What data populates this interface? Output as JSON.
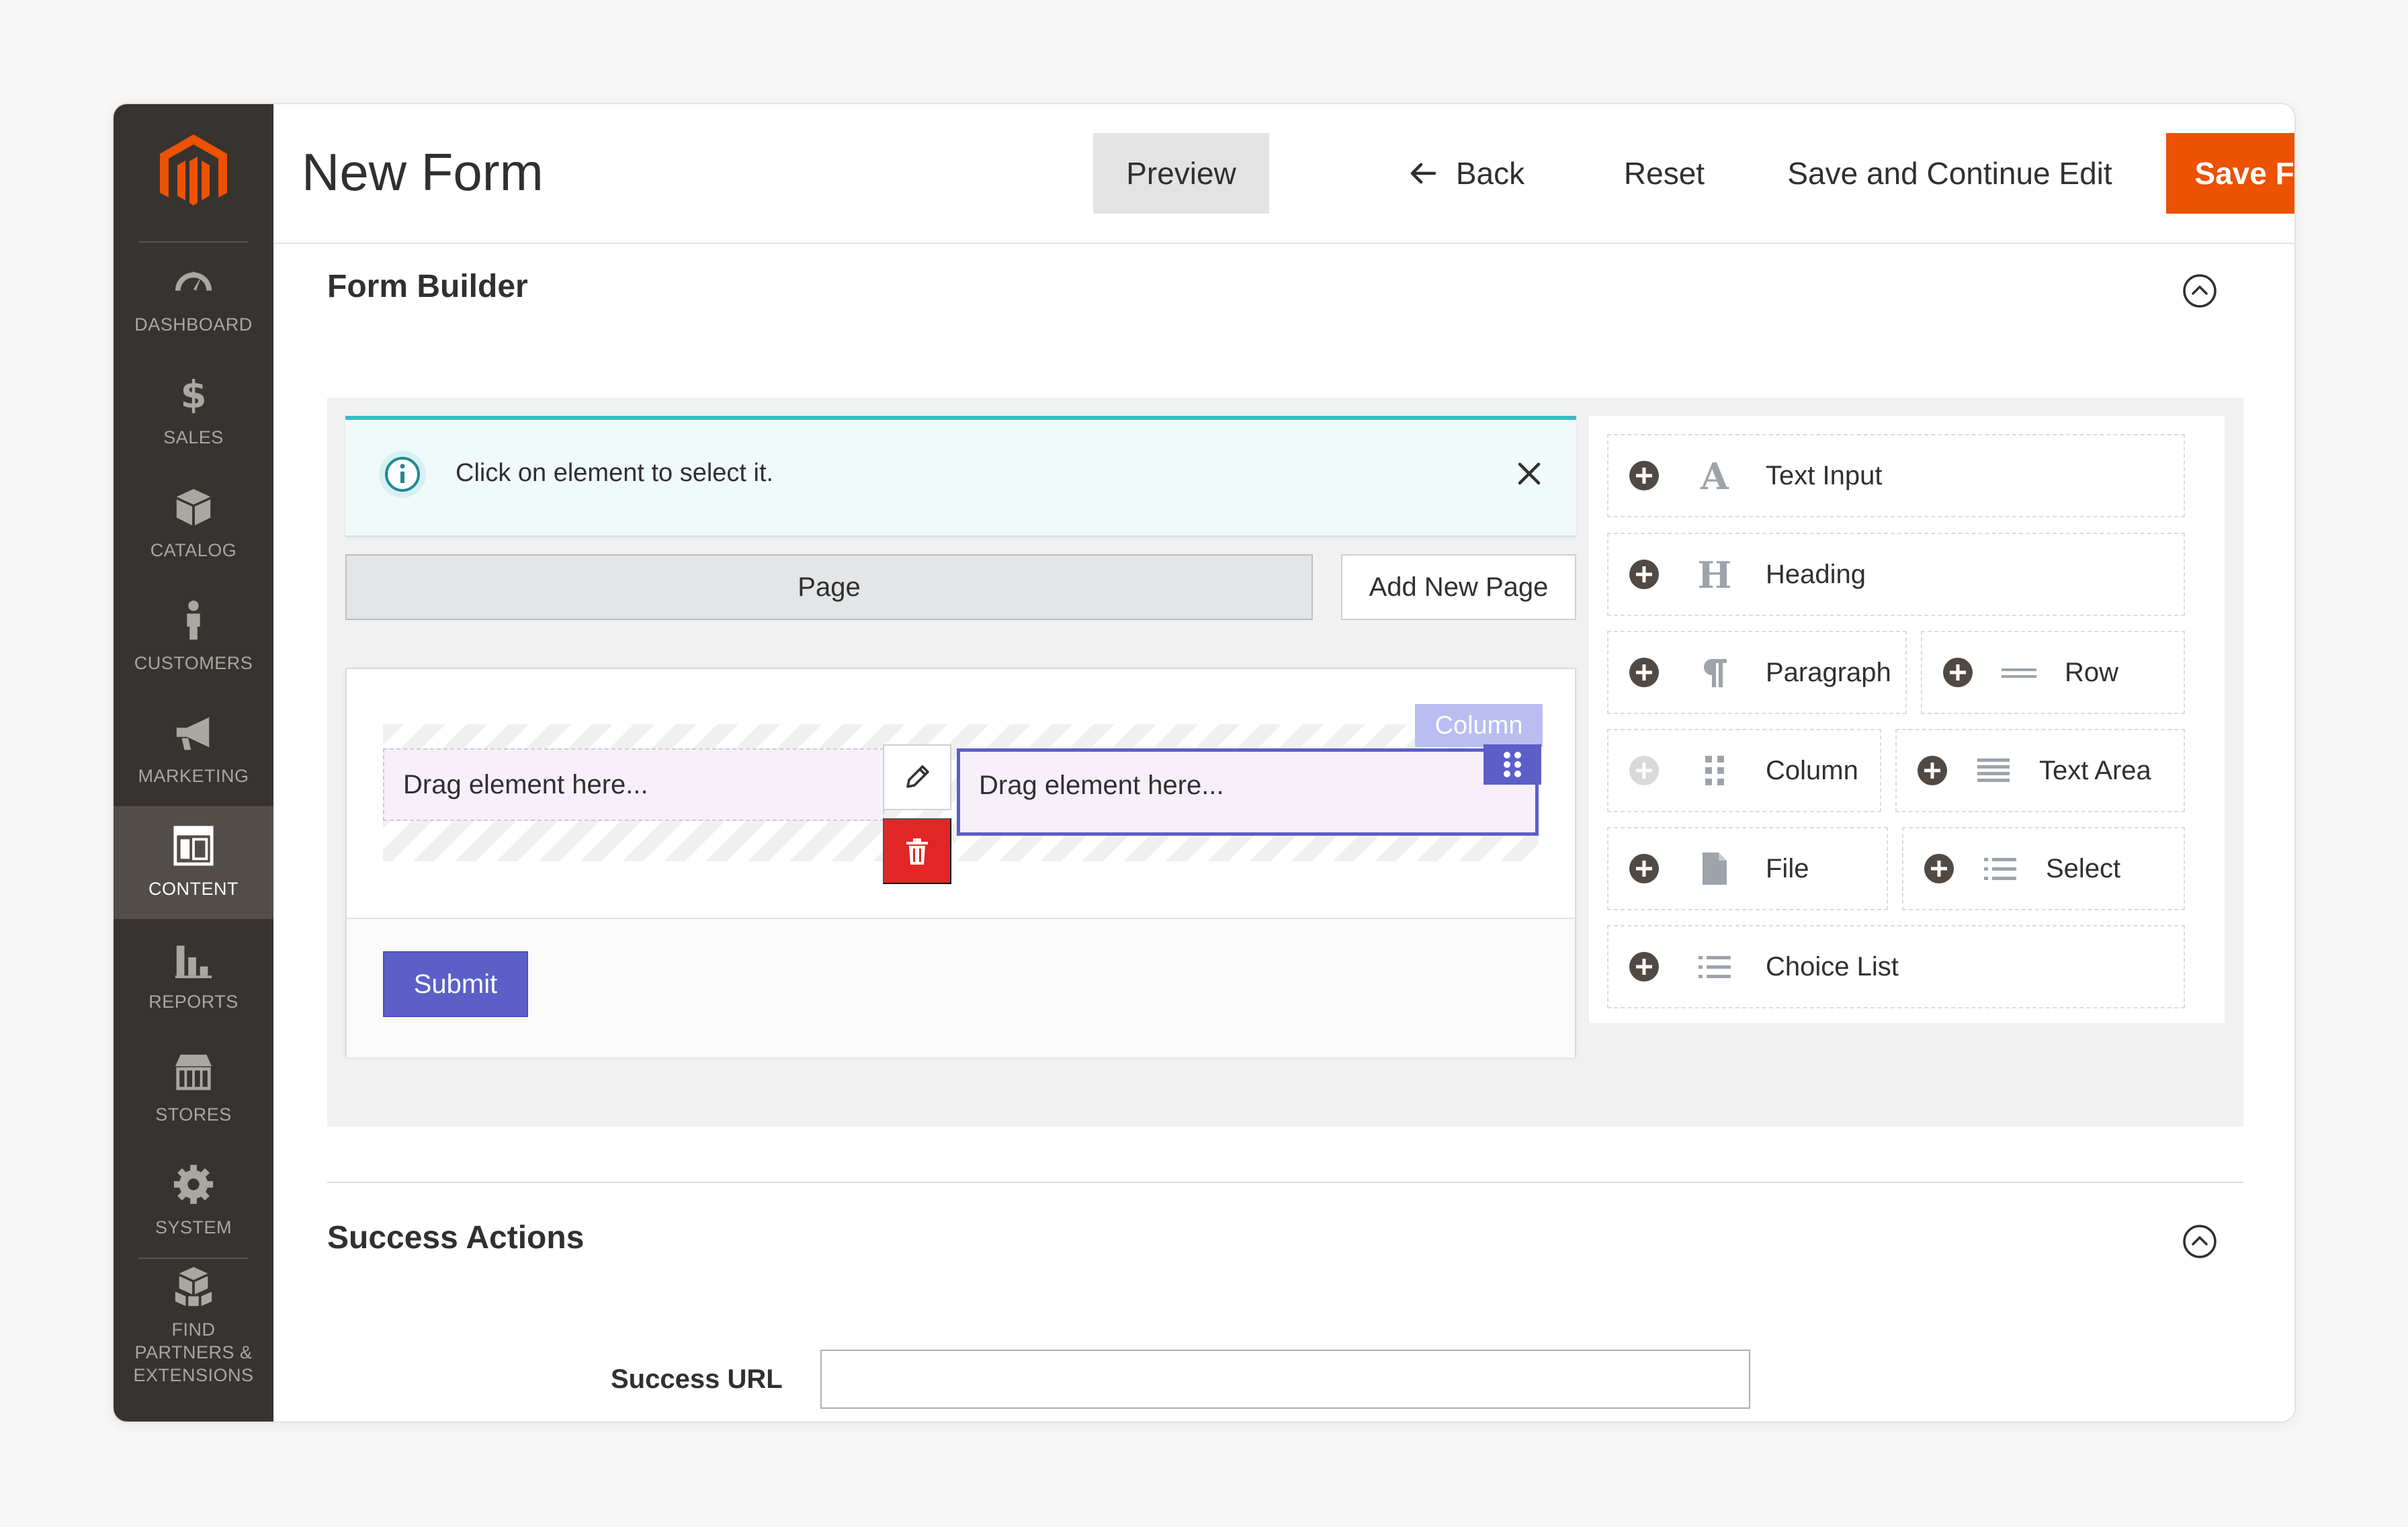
{
  "app": {
    "page_title": "New Form",
    "colors": {
      "accent": "#eb5202",
      "primary": "#5b5fc7",
      "sidebar": "#373330",
      "notice_border": "#3cbbc4",
      "danger": "#e22626"
    }
  },
  "sidebar": {
    "logo": "magento-logo",
    "items": [
      {
        "label": "DASHBOARD",
        "icon": "dashboard-icon"
      },
      {
        "label": "SALES",
        "icon": "dollar-icon"
      },
      {
        "label": "CATALOG",
        "icon": "box-icon"
      },
      {
        "label": "CUSTOMERS",
        "icon": "person-icon"
      },
      {
        "label": "MARKETING",
        "icon": "megaphone-icon"
      },
      {
        "label": "CONTENT",
        "icon": "layout-icon",
        "active": true
      },
      {
        "label": "REPORTS",
        "icon": "bar-chart-icon"
      },
      {
        "label": "STORES",
        "icon": "store-icon"
      },
      {
        "label": "SYSTEM",
        "icon": "gear-icon"
      },
      {
        "label": "FIND PARTNERS & EXTENSIONS",
        "icon": "cubes-icon"
      }
    ]
  },
  "header": {
    "preview": "Preview",
    "back": "Back",
    "reset": "Reset",
    "save_continue": "Save and Continue Edit",
    "save_form": "Save Form"
  },
  "form_builder": {
    "title": "Form Builder",
    "notice": "Click on element to select it.",
    "page_tab": "Page",
    "add_page": "Add New Page",
    "column_tag": "Column",
    "drop_left": "Drag element here...",
    "drop_right": "Drag element here...",
    "submit": "Submit",
    "palette": [
      {
        "label": "Text Input",
        "icon": "letter-a-icon"
      },
      {
        "label": "Heading",
        "icon": "letter-h-icon"
      },
      {
        "label": "Paragraph",
        "icon": "pilcrow-icon"
      },
      {
        "label": "Row",
        "icon": "row-lines-icon"
      },
      {
        "label": "Column",
        "icon": "grip-icon",
        "disabled": true
      },
      {
        "label": "Text Area",
        "icon": "text-lines-icon"
      },
      {
        "label": "File",
        "icon": "file-icon"
      },
      {
        "label": "Select",
        "icon": "list-icon"
      },
      {
        "label": "Choice List",
        "icon": "list-icon"
      }
    ]
  },
  "success_actions": {
    "title": "Success Actions",
    "url_label": "Success URL",
    "url_value": ""
  }
}
